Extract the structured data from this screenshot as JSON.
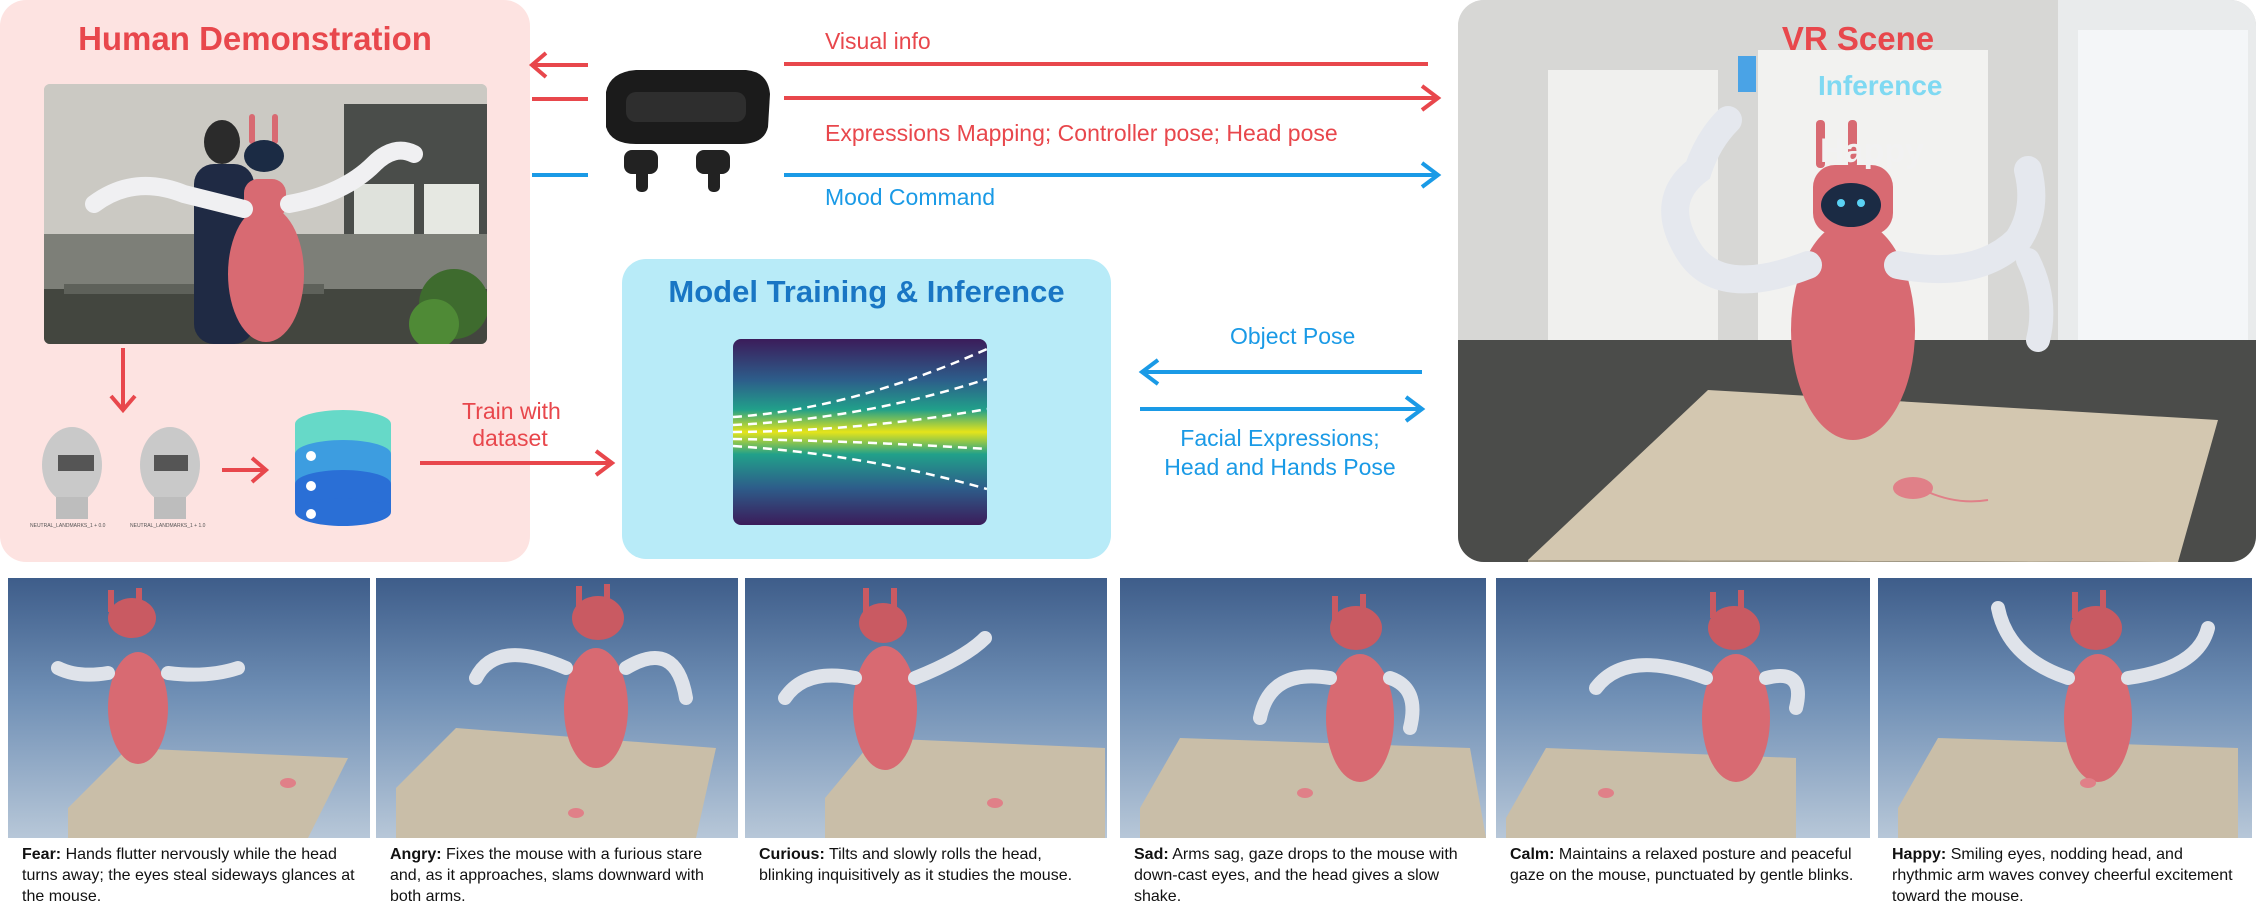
{
  "human_panel": {
    "title": "Human Demonstration",
    "face_caption_1": "NEUTRAL_LANDMARKS_1 + 0.0",
    "face_caption_2": "NEUTRAL_LANDMARKS_1 + 1.0"
  },
  "train_label_line1": "Train with",
  "train_label_line2": "dataset",
  "top_arrows": {
    "visual_info": "Visual info",
    "expressions_mapping": "Expressions Mapping; Controller pose; Head pose",
    "mood_command": "Mood Command"
  },
  "model_panel": {
    "title": "Model Training & Inference"
  },
  "right_arrows": {
    "object_pose": "Object Pose",
    "facial_line1": "Facial Expressions;",
    "facial_line2": "Head and Hands Pose"
  },
  "vr_panel": {
    "title": "VR Scene",
    "inference_overlay": "Inference",
    "happy_overlay": "Happy"
  },
  "colors": {
    "red": "#e8474c",
    "blue": "#1a9ae6",
    "pink_panel": "#fde3e1",
    "cyan_panel": "#b8ebf8",
    "robot_body": "#d86a72"
  },
  "moods": [
    {
      "name": "Fear:",
      "desc": "Hands flutter nervously while the head turns away; the eyes steal sideways glances at the mouse."
    },
    {
      "name": "Angry:",
      "desc": "Fixes the mouse with a furious stare and, as it approaches, slams downward with both arms."
    },
    {
      "name": "Curious:",
      "desc": "Tilts and slowly rolls the head, blinking inquisitively as it studies the mouse."
    },
    {
      "name": "Sad:",
      "desc": "Arms sag, gaze drops to the mouse with down-cast eyes, and the head gives a slow shake."
    },
    {
      "name": "Calm:",
      "desc": "Maintains a relaxed posture and peaceful gaze on the mouse, punctuated by gentle blinks."
    },
    {
      "name": "Happy:",
      "desc": "Smiling eyes, nodding head, and rhythmic arm waves convey cheerful excitement toward the mouse."
    }
  ]
}
